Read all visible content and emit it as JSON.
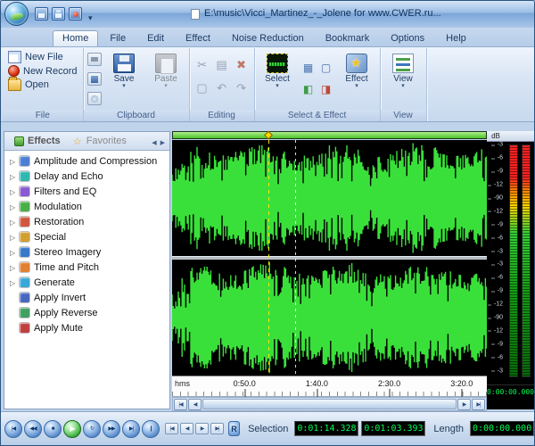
{
  "colors": {
    "waveform_green": "#3ae03a",
    "lcd_green": "#00ff55",
    "overview_green": "#49c226",
    "meter_red": "#ff2222",
    "meter_yellow": "#ffd400",
    "meter_green": "#35d035",
    "accent_blue": "#3a6ca8"
  },
  "titlebar": {
    "title": "E:\\music\\Vicci_Martinez_-_Jolene for www.CWER.ru...",
    "icons": [
      {
        "name": "save-icon",
        "cls": "q-save"
      },
      {
        "name": "save-all-icon",
        "cls": "q-saveall"
      },
      {
        "name": "record-icon",
        "cls": "q-rec"
      }
    ]
  },
  "tabs": [
    {
      "label": "Home",
      "active": true
    },
    {
      "label": "File"
    },
    {
      "label": "Edit"
    },
    {
      "label": "Effect"
    },
    {
      "label": "Noise Reduction"
    },
    {
      "label": "Bookmark"
    },
    {
      "label": "Options"
    },
    {
      "label": "Help"
    }
  ],
  "ribbon": {
    "file_group": {
      "label": "File",
      "buttons": [
        {
          "label": "New File",
          "name": "new-file-button",
          "cls": "c-newfile"
        },
        {
          "label": "New Record",
          "name": "new-record-button",
          "cls": "c-newrec"
        },
        {
          "label": "Open",
          "name": "open-button",
          "cls": "c-open"
        }
      ]
    },
    "clipboard_group": {
      "label": "Clipboard",
      "save_label": "Save",
      "paste_label": "Paste"
    },
    "editing_group": {
      "label": "Editing",
      "icons": [
        {
          "name": "cut-icon",
          "glyph": "✂"
        },
        {
          "name": "copy-icon",
          "glyph": "▤"
        },
        {
          "name": "delete-icon",
          "glyph": "✖",
          "cls": "red"
        },
        {
          "name": "crop-icon",
          "glyph": "▢"
        },
        {
          "name": "undo-icon",
          "glyph": "↶"
        },
        {
          "name": "redo-icon",
          "glyph": "↷"
        }
      ]
    },
    "select_effect_group": {
      "label": "Select & Effect",
      "select_label": "Select",
      "effect_label": "Effect",
      "icons": [
        {
          "name": "select-all-icon",
          "glyph": "▦"
        },
        {
          "name": "deselect-icon",
          "glyph": "▢"
        },
        {
          "name": "zoom-selection-icon",
          "glyph": "◧",
          "cls": "green"
        },
        {
          "name": "marker-icon",
          "glyph": "◨",
          "cls": "red"
        }
      ]
    },
    "view_group": {
      "label": "View",
      "view_label": "View"
    }
  },
  "sidebar": {
    "tabs": [
      {
        "label": "Effects",
        "active": true,
        "cls": "fx",
        "name": "tab-effects"
      },
      {
        "label": "Favorites",
        "cls": "fav",
        "name": "tab-favorites"
      }
    ],
    "items": [
      {
        "label": "Amplitude and Compression",
        "color": "#4a7fd4",
        "name": "effect-amplitude-and-compression"
      },
      {
        "label": "Delay and Echo",
        "color": "#30b8b0",
        "name": "effect-delay-and-echo"
      },
      {
        "label": "Filters and EQ",
        "color": "#8a5ad0",
        "name": "effect-filters-and-eq"
      },
      {
        "label": "Modulation",
        "color": "#48b048",
        "name": "effect-modulation"
      },
      {
        "label": "Restoration",
        "color": "#d05840",
        "name": "effect-restoration"
      },
      {
        "label": "Special",
        "color": "#d0a030",
        "name": "effect-special"
      },
      {
        "label": "Stereo Imagery",
        "color": "#3878c8",
        "name": "effect-stereo-imagery"
      },
      {
        "label": "Time and Pitch",
        "color": "#e08030",
        "name": "effect-time-and-pitch"
      },
      {
        "label": "Generate",
        "color": "#38a8d8",
        "name": "effect-generate"
      },
      {
        "label": "Apply Invert",
        "color": "#4868c0",
        "cls": "leaf",
        "name": "effect-apply-invert"
      },
      {
        "label": "Apply Reverse",
        "color": "#40a060",
        "cls": "leaf",
        "name": "effect-apply-reverse"
      },
      {
        "label": "Apply Mute",
        "color": "#c04040",
        "cls": "leaf",
        "name": "effect-apply-mute"
      }
    ]
  },
  "waveform": {
    "db_unit": "dB",
    "db_labels": [
      "-3",
      "-6",
      "-9",
      "-12",
      "-90",
      "-12",
      "-9",
      "-6",
      "-3"
    ],
    "timeline_unit": "hms",
    "time_labels": [
      {
        "label": "0:50.0",
        "pct": 23
      },
      {
        "label": "1:40.0",
        "pct": 46
      },
      {
        "label": "2:30.0",
        "pct": 69
      },
      {
        "label": "3:20.0",
        "pct": 92
      }
    ],
    "cursor_pct": 30.5,
    "marker_pct": 39
  },
  "scrollbar": {
    "left_buttons": [
      {
        "glyph": "|◀",
        "name": "scroll-far-left-button"
      },
      {
        "glyph": "◀",
        "name": "scroll-left-button"
      }
    ],
    "right_buttons": [
      {
        "glyph": "▶",
        "name": "scroll-right-button"
      },
      {
        "glyph": "▶|",
        "name": "scroll-far-right-button"
      }
    ]
  },
  "transport": {
    "buttons": [
      {
        "glyph": "|◀",
        "name": "go-to-start-button"
      },
      {
        "glyph": "◀◀",
        "name": "rewind-button"
      },
      {
        "glyph": "■",
        "name": "stop-button"
      },
      {
        "glyph": "▶",
        "name": "play-button",
        "cls": "play"
      },
      {
        "glyph": "↻",
        "name": "loop-button"
      },
      {
        "glyph": "▶▶",
        "name": "fast-forward-button"
      },
      {
        "glyph": "▶|",
        "name": "go-to-end-button"
      },
      {
        "glyph": "||",
        "name": "pause-button"
      }
    ],
    "nav_buttons": [
      {
        "glyph": "|◀",
        "name": "seek-start-button"
      },
      {
        "glyph": "◀",
        "name": "seek-back-button"
      },
      {
        "glyph": "▶",
        "name": "seek-forward-button"
      },
      {
        "glyph": "▶|",
        "name": "seek-end-button"
      }
    ],
    "record_label": "R",
    "selection_label": "Selection",
    "selection_start": "0:01:14.328",
    "selection_length": "0:01:03.393",
    "length_label": "Length",
    "length_value": "0:00:00.000",
    "position_value": "0:00:00.000"
  }
}
